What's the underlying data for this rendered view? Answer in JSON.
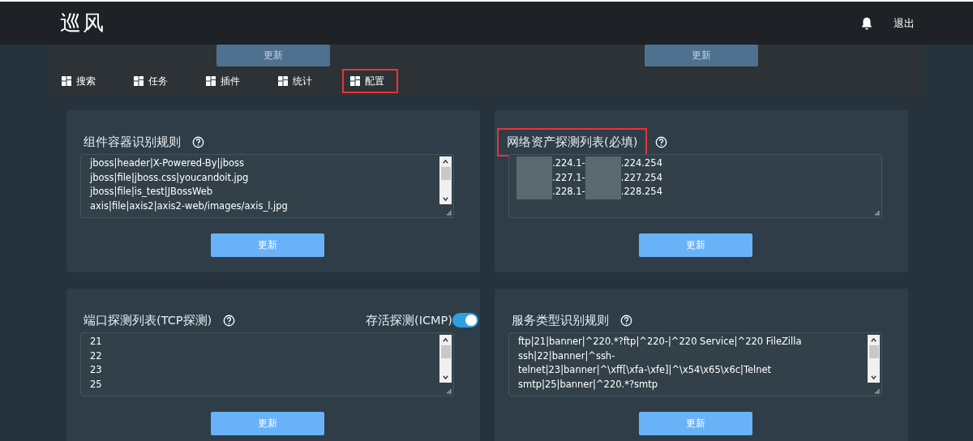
{
  "header": {
    "logo": "巡风",
    "logout": "退出"
  },
  "nav": [
    {
      "label": "搜索",
      "selected": false
    },
    {
      "label": "任务",
      "selected": false
    },
    {
      "label": "插件",
      "selected": false
    },
    {
      "label": "统计",
      "selected": false
    },
    {
      "label": "配置",
      "selected": true
    }
  ],
  "hidden_buttons": [
    "更新",
    "更新"
  ],
  "cards": [
    {
      "kind": "text",
      "title": "组件容器识别规则",
      "highlighted": false,
      "scrollbar": true,
      "lines": [
        "jboss|header|X-Powered-By|jboss",
        "jboss|file|jboss.css|youcandoit.jpg",
        "jboss|file|is_test|JBossWeb",
        "axis|file|axis2|axis2-web/images/axis_l.jpg"
      ],
      "button": "更新"
    },
    {
      "kind": "redacted",
      "title": "网络资产探测列表(必填)",
      "highlighted": true,
      "scrollbar": false,
      "lines": [
        {
          "start": ".224.1-",
          "end": ".224.254"
        },
        {
          "start": ".227.1-",
          "end": ".227.254"
        },
        {
          "start": ".228.1-",
          "end": ".228.254"
        }
      ],
      "button": "更新"
    },
    {
      "kind": "text",
      "title": "端口探测列表(TCP探测)",
      "highlighted": false,
      "scrollbar": true,
      "toggle": {
        "label": "存活探测(ICMP)",
        "on": true
      },
      "lines": [
        "21",
        "22",
        "23",
        "25"
      ],
      "button": "更新"
    },
    {
      "kind": "text",
      "title": "服务类型识别规则",
      "highlighted": false,
      "scrollbar": true,
      "lines": [
        "ftp|21|banner|^220.*?ftp|^220-|^220 Service|^220 FileZilla",
        "ssh|22|banner|^ssh-",
        "telnet|23|banner|^\\xff[\\xfa-\\xfe]|^\\x54\\x65\\x6c|Telnet",
        "smtp|25|banner|^220.*?smtp"
      ],
      "button": "更新"
    }
  ]
}
